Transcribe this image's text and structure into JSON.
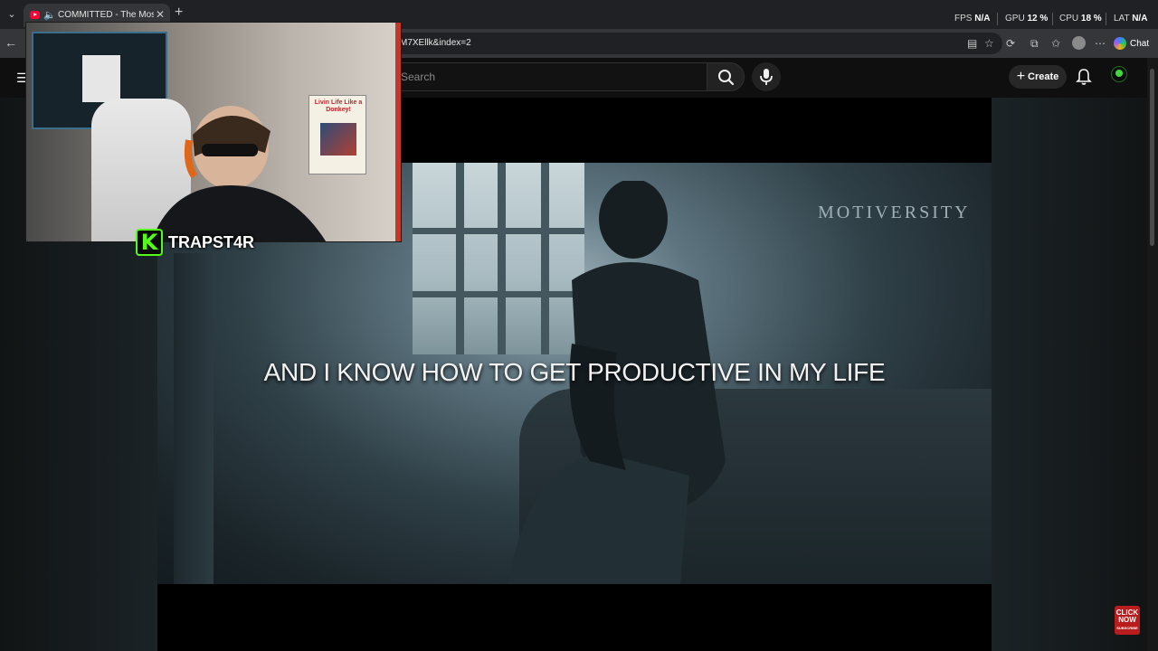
{
  "browser": {
    "tab": {
      "title": "COMMITTED - The Most Pow",
      "close": "✕"
    },
    "new_tab": "+",
    "url": "M7XEllk&index=2",
    "perf": [
      {
        "label": "FPS",
        "value": "N/A"
      },
      {
        "label": "GPU",
        "value": "12 %"
      },
      {
        "label": "CPU",
        "value": "18 %"
      },
      {
        "label": "LAT",
        "value": "N/A"
      }
    ],
    "chat_label": "Chat"
  },
  "youtube": {
    "search_placeholder": "Search",
    "create_label": "Create",
    "video": {
      "watermark": "MOTIVERSITY",
      "caption": "AND I KNOW HOW TO GET PRODUCTIVE IN MY LIFE",
      "subscribe_badge": [
        "CLICK",
        "NOW",
        "SUBSCRIBE"
      ]
    }
  },
  "stream_overlay": {
    "streamer_name": "TRAPST4R",
    "brand_letter": "K",
    "poster_text": "Livin Life Like a Donkey!"
  },
  "colors": {
    "kick_green": "#53fc18",
    "youtube_red": "#ff0033",
    "background": "#0f0f0f"
  }
}
